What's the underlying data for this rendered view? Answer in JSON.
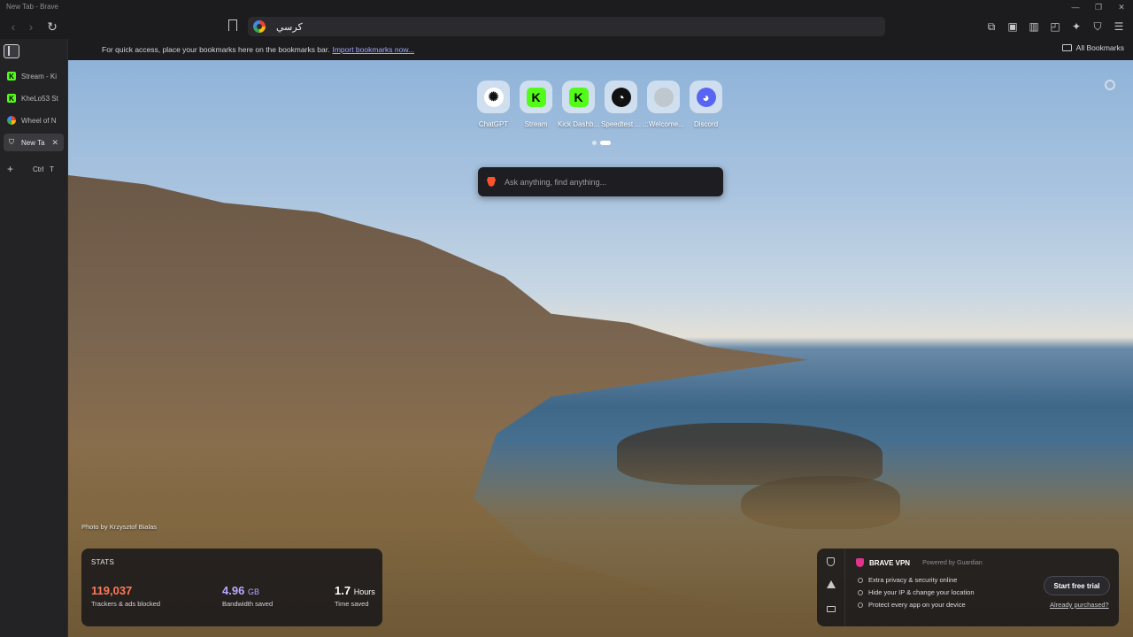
{
  "window": {
    "title": "New Tab - Brave"
  },
  "toolbar": {
    "url": "كرسي",
    "back_icon": "arrow-left-icon",
    "forward_icon": "arrow-right-icon",
    "reload_icon": "reload-icon"
  },
  "bookmarks_bar": {
    "message": "For quick access, place your bookmarks here on the bookmarks bar.",
    "import_link": "Import bookmarks now...",
    "all_bookmarks": "All Bookmarks"
  },
  "tabs": [
    {
      "label": "Stream - Ki",
      "favicon": "kick"
    },
    {
      "label": "KheLo53 St",
      "favicon": "kick"
    },
    {
      "label": "Wheel of N",
      "favicon": "wheel"
    },
    {
      "label": "New Ta",
      "favicon": "shield",
      "active": true
    }
  ],
  "new_tab": {
    "plus": "+",
    "shortcut_ctrl": "Ctrl",
    "shortcut_key": "T"
  },
  "top_sites": [
    {
      "label": "ChatGPT",
      "glyph": "✺"
    },
    {
      "label": "Stream",
      "glyph": "K"
    },
    {
      "label": "Kick Dashb...",
      "glyph": "K"
    },
    {
      "label": "Speedtest ...",
      "glyph": "◔"
    },
    {
      "label": ".::Welcome...",
      "glyph": ""
    },
    {
      "label": "Discord",
      "glyph": "◕"
    }
  ],
  "search": {
    "placeholder": "Ask anything, find anything..."
  },
  "photo_credit": "Photo by Krzysztof Bialas",
  "stats": {
    "heading": "STATS",
    "trackers": {
      "value": "119,037",
      "label": "Trackers & ads blocked",
      "color": "#ff7a59"
    },
    "bandwidth": {
      "value": "4.96",
      "unit": "GB",
      "label": "Bandwidth saved",
      "color": "#b9a7ff"
    },
    "time": {
      "value": "1.7",
      "unit": "Hours",
      "label": "Time saved",
      "color": "#ffffff"
    }
  },
  "vpn": {
    "title": "BRAVE VPN",
    "powered": "Powered by Guardian",
    "features": [
      "Extra privacy & security online",
      "Hide your IP & change your location",
      "Protect every app on your device"
    ],
    "cta": "Start free trial",
    "already": "Already purchased?"
  }
}
